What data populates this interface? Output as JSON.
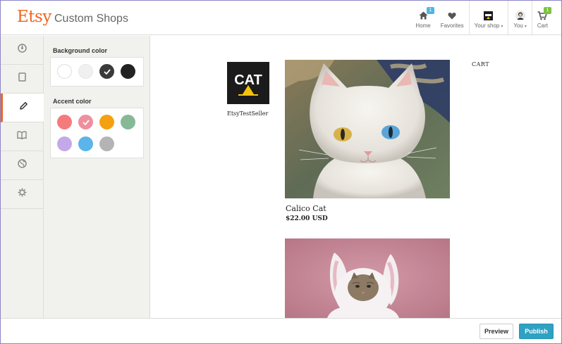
{
  "header": {
    "logo": "Etsy",
    "title": "Custom Shops",
    "nav": [
      {
        "label": "Home",
        "icon": "home-icon",
        "badge": "1",
        "badge_color": "#4db6e6"
      },
      {
        "label": "Favorites",
        "icon": "heart-icon"
      },
      {
        "label": "Your shop",
        "icon": "shop-icon",
        "caret": "▾"
      },
      {
        "label": "You",
        "icon": "avatar-icon",
        "caret": "▾"
      },
      {
        "label": "Cart",
        "icon": "cart-icon",
        "badge": "1",
        "badge_color": "#7cc242"
      }
    ]
  },
  "rail": {
    "items": [
      "dashboard-icon",
      "page-icon",
      "pencil-icon",
      "book-icon",
      "globe-icon",
      "gear-icon"
    ],
    "active_index": 2,
    "active_color": "#f1641e"
  },
  "panel": {
    "background_label": "Background color",
    "background_colors": [
      "#ffffff",
      "#f0f0f0",
      "#3a3a3a",
      "#222222"
    ],
    "background_selected": 2,
    "accent_label": "Accent color",
    "accent_colors": [
      "#f57b7b",
      "#ef8f9d",
      "#f5a010",
      "#86b995",
      "#c4a9e8",
      "#5bb4ea",
      "#b4b4b4"
    ],
    "accent_selected": 1
  },
  "preview": {
    "shop_logo_text": "CAT",
    "shop_name": "EtsyTestSeller",
    "cart_label": "CART",
    "listings": [
      {
        "title": "Calico Cat",
        "price": "$22.00 USD"
      }
    ]
  },
  "footer": {
    "preview_label": "Preview",
    "publish_label": "Publish"
  }
}
